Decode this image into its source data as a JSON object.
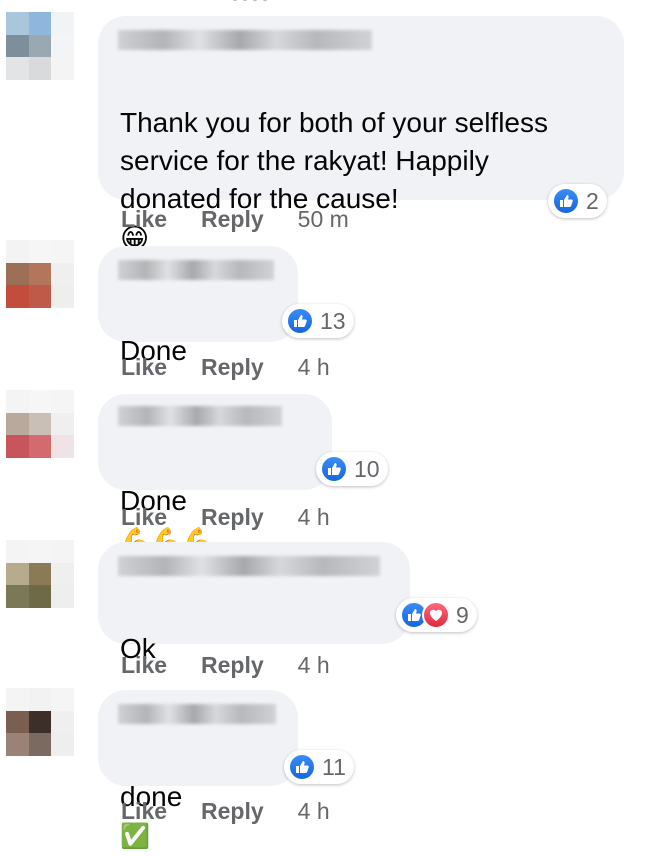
{
  "comments": [
    {
      "avatar_colors": [
        "#a9c6dd",
        "#8fb7dd",
        "#f2f3f5",
        "#7e8f9c",
        "#9aa8b2",
        "#f3f4f6",
        "#e3e4e6",
        "#d9dadc",
        "#f4f4f5"
      ],
      "text": "Thank you for both of your selfless\nservice for the rakyat! Happily\ndonated for the cause!",
      "emoji": "😁",
      "reactions": [
        "like"
      ],
      "reaction_count": "2",
      "like_label": "Like",
      "reply_label": "Reply",
      "time": "50 m"
    },
    {
      "avatar_colors": [
        "#f3f3f3",
        "#f6f6f6",
        "#f5f5f5",
        "#9d6e58",
        "#b3765c",
        "#efefef",
        "#c24d3c",
        "#bf5a48",
        "#eeeeee"
      ],
      "text": "Done",
      "emoji": "",
      "reactions": [
        "like"
      ],
      "reaction_count": "13",
      "like_label": "Like",
      "reply_label": "Reply",
      "time": "4 h"
    },
    {
      "avatar_colors": [
        "#f4f4f4",
        "#f6f6f6",
        "#f5f5f5",
        "#b9a89c",
        "#c9bfb6",
        "#efefef",
        "#c9555c",
        "#d26a70",
        "#f0e3e5"
      ],
      "text": "Done",
      "emoji": "💪💪💪",
      "reactions": [
        "like"
      ],
      "reaction_count": "10",
      "like_label": "Like",
      "reply_label": "Reply",
      "time": "4 h"
    },
    {
      "avatar_colors": [
        "#f4f4f4",
        "#f5f5f5",
        "#f4f4f4",
        "#b6ab8c",
        "#8a7a55",
        "#efefef",
        "#7b7858",
        "#6e6a48",
        "#eeeeee"
      ],
      "text": "Ok",
      "emoji": "",
      "reactions": [
        "like",
        "love"
      ],
      "reaction_count": "9",
      "like_label": "Like",
      "reply_label": "Reply",
      "time": "4 h"
    },
    {
      "avatar_colors": [
        "#f4f4f4",
        "#f2f2f2",
        "#f5f5f5",
        "#7a5e50",
        "#3c2f2a",
        "#efefef",
        "#9a8376",
        "#7b6a5f",
        "#eeeeee"
      ],
      "text": "done",
      "emoji": "✅",
      "reactions": [
        "like"
      ],
      "reaction_count": "11",
      "like_label": "Like",
      "reply_label": "Reply",
      "time": "4 h"
    }
  ],
  "colors": {
    "bubble": "#f0f2f5",
    "meta_text": "#65676b",
    "like_blue": "#1877f2",
    "love_red": "#f33e58"
  }
}
